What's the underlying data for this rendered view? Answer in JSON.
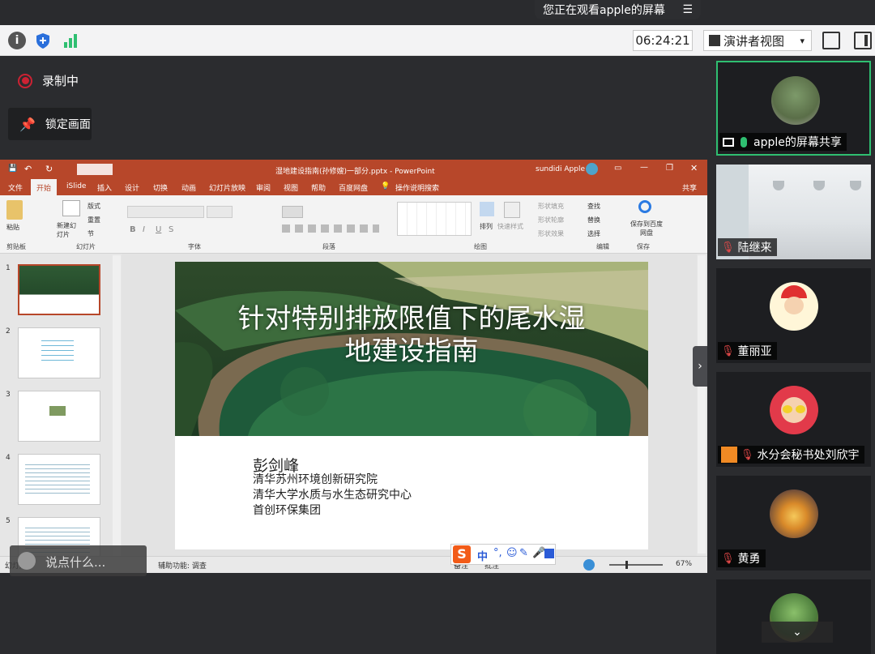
{
  "notice": {
    "text": "您正在观看apple的屏幕",
    "menu_icon": "menu-icon"
  },
  "toolbar": {
    "time": "06:24:21",
    "view_label": "演讲者视图",
    "dropdown_icon": "▾"
  },
  "stage": {
    "recording_label": "录制中",
    "lock_label": "锁定画面"
  },
  "ppt": {
    "title": "湿地建设指南(孙修嫂)一部分.pptx - PowerPoint",
    "account": "sundidi Apple",
    "tabs": [
      "文件",
      "开始",
      "iSlide",
      "插入",
      "设计",
      "切换",
      "动画",
      "幻灯片放映",
      "审阅",
      "视图",
      "帮助",
      "百度网盘",
      "操作说明搜索"
    ],
    "share_label": "共享",
    "groups": [
      "剪贴板",
      "幻灯片",
      "字体",
      "段落",
      "绘图",
      "编辑",
      "保存"
    ],
    "ribbon_items": {
      "paste": "粘贴",
      "new_slide": "新建幻灯片",
      "layout": "版式",
      "reset": "重置",
      "section": "节",
      "arrange": "排列",
      "quick_style": "快速样式",
      "find": "查找",
      "replace": "替换",
      "select": "选择",
      "save_baidu": "保存到百度网盘",
      "shape_fill": "形状填充",
      "shape_outline": "形状轮廓",
      "shape_effect": "形状效果"
    },
    "thumb_numbers": [
      "1",
      "2",
      "3",
      "4",
      "5"
    ],
    "slide": {
      "title_line1": "针对特别排放限值下的尾水湿",
      "title_line2": "地建设指南",
      "author": "彭剑峰",
      "affiliations": [
        "清华苏州环境创新研究院",
        "清华大学水质与水生态研究中心",
        "首创环保集团"
      ]
    },
    "status": {
      "slide_info": "幻灯片",
      "accessibility": "辅助功能: 调查",
      "notes": "备注",
      "comments": "批注",
      "zoom": "67%"
    }
  },
  "chat": {
    "placeholder": "说点什么..."
  },
  "ime": {
    "label": "中"
  },
  "participants": [
    {
      "name": "apple的屏幕共享",
      "mic": "on"
    },
    {
      "name": "陆继来",
      "mic": "off"
    },
    {
      "name": "董丽亚",
      "mic": "off"
    },
    {
      "name": "水分会秘书处刘欣宇",
      "mic": "off"
    },
    {
      "name": "黄勇",
      "mic": "off"
    }
  ],
  "colors": {
    "ppt_accent": "#b7472a",
    "active_border": "#2fbf71",
    "mic_on": "#2fbf71",
    "mic_off": "#e04848"
  }
}
